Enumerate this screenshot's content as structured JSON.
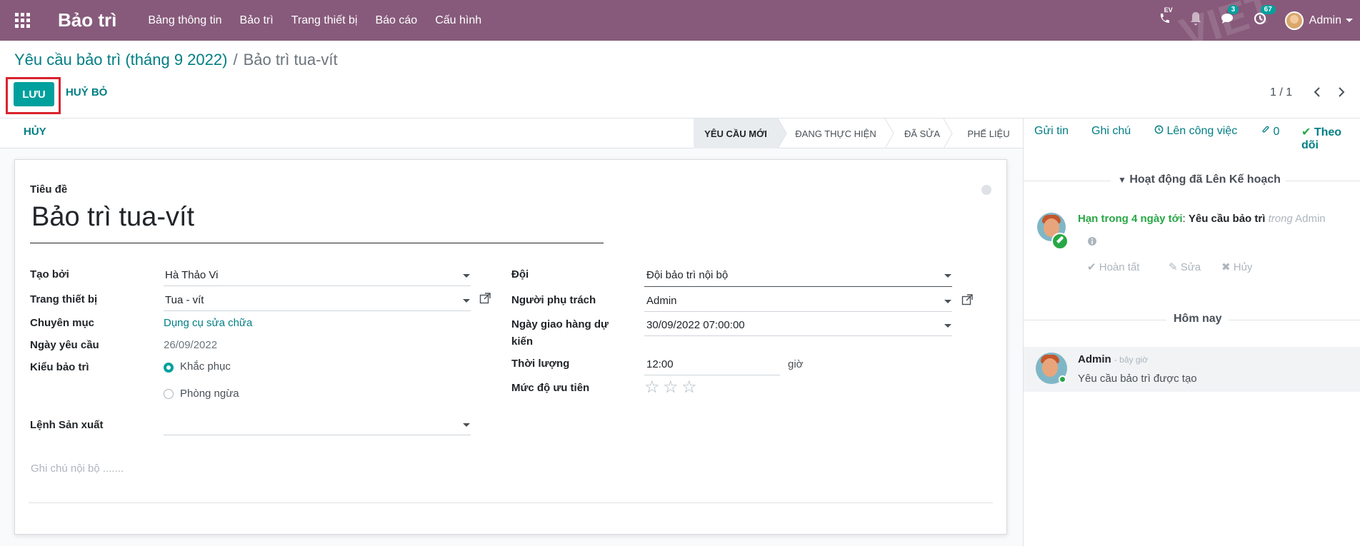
{
  "navbar": {
    "app_name": "Bảo trì",
    "menu": [
      "Bảng thông tin",
      "Bảo trì",
      "Trang thiết bị",
      "Báo cáo",
      "Cấu hình"
    ],
    "phone_badge": "EV",
    "messages_badge": "3",
    "activities_badge": "67",
    "user": "Admin",
    "watermark": "VIET"
  },
  "breadcrumb": {
    "parent": "Yêu cầu bảo trì (tháng 9 2022)",
    "separator": "/",
    "current": "Bảo trì tua-vít"
  },
  "actions": {
    "save": "LƯU",
    "discard": "HUỶ BỎ"
  },
  "pager": {
    "value": "1 / 1"
  },
  "statusbar": {
    "cancel": "HỦY",
    "stages": [
      "YÊU CẦU MỚI",
      "ĐANG THỰC HIỆN",
      "ĐÃ SỬA",
      "PHẾ LIỆU"
    ],
    "active_stage": "YÊU CẦU MỚI"
  },
  "form": {
    "title_label": "Tiêu đề",
    "title": "Bảo trì tua-vít",
    "created_by_label": "Tạo bởi",
    "created_by": "Hà Thảo Vi",
    "equipment_label": "Trang thiết bị",
    "equipment": "Tua - vít",
    "category_label": "Chuyên mục",
    "category": "Dụng cụ sửa chữa",
    "request_date_label": "Ngày yêu cầu",
    "request_date": "26/09/2022",
    "maintenance_type_label": "Kiểu bảo trì",
    "type_corrective": "Khắc phục",
    "type_preventive": "Phòng ngừa",
    "production_order_label": "Lệnh Sản xuất",
    "team_label": "Đội",
    "team": "Đội bảo trì nội bộ",
    "responsible_label": "Người phụ trách",
    "responsible": "Admin",
    "scheduled_date_label_1": "Ngày giao hàng dự",
    "scheduled_date_label_2": "kiến",
    "scheduled_date": "30/09/2022 07:00:00",
    "duration_label": "Thời lượng",
    "duration": "12:00",
    "duration_unit": "giờ",
    "priority_label": "Mức độ ưu tiên",
    "priority_value": 0,
    "priority_max": 3,
    "notes_placeholder": "Ghi chú nội bộ ......."
  },
  "chatter": {
    "send_message": "Gửi tin",
    "log_note": "Ghi chú",
    "schedule_activity": "Lên công việc",
    "attachments": "0",
    "follow": "Theo dõi",
    "planned_heading": "Hoạt động đã Lên Kế hoạch",
    "activity": {
      "due": "Hạn trong 4 ngày tới",
      "colon": ":",
      "summary": "Yêu cầu bảo trì",
      "in_word": "trong",
      "assignee": "Admin",
      "done": "Hoàn tất",
      "edit": "Sửa",
      "cancel": "Hủy"
    },
    "today_heading": "Hôm nay",
    "message": {
      "author": "Admin",
      "time": "- bây giờ",
      "body": "Yêu cầu bảo trì được tạo"
    }
  },
  "colors": {
    "navbar": "#875a7b",
    "primary": "#00a09d",
    "link": "#017e84",
    "highlight_border": "#d9232d"
  }
}
